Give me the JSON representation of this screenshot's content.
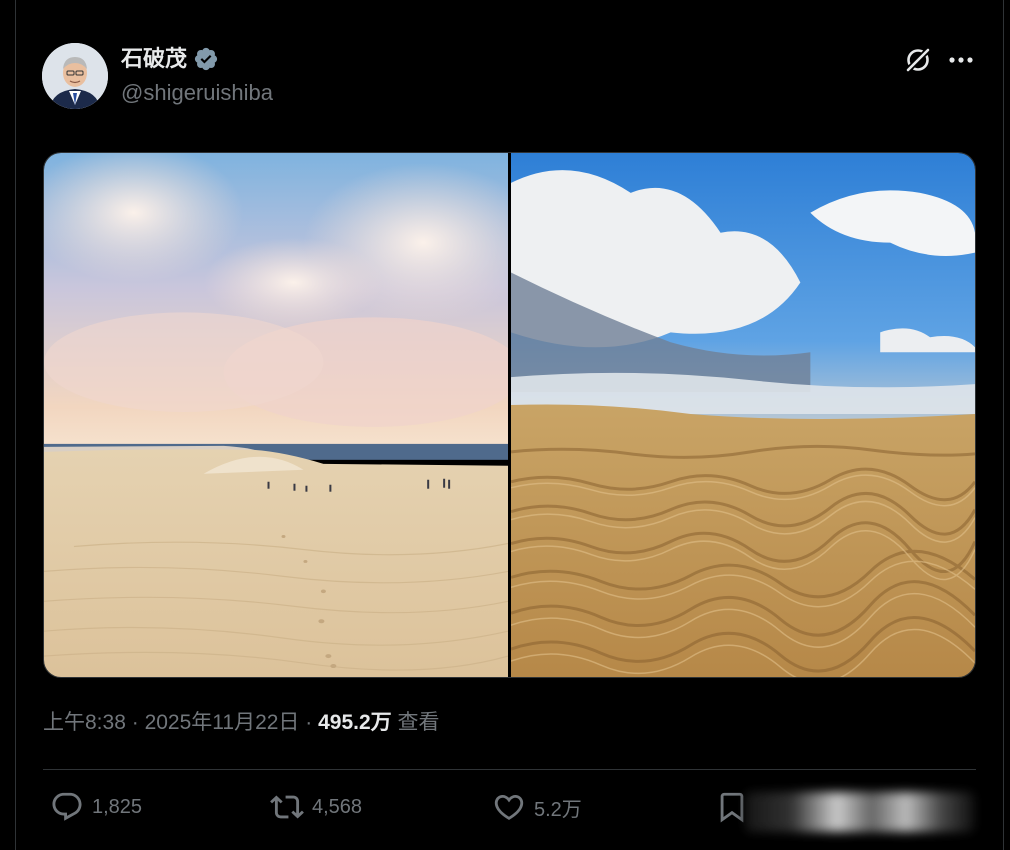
{
  "tweet": {
    "author": {
      "display_name": "石破茂",
      "handle": "@shigeruishiba",
      "verified": true,
      "badge_color": "#829aab"
    },
    "timestamp": {
      "time": "上午8:38",
      "separator": "·",
      "date": "2025年11月22日",
      "views_count": "495.2万",
      "views_label": "查看"
    },
    "media": [
      {
        "icon": "photo-sand-dunes-with-people"
      },
      {
        "icon": "photo-sand-ripples-blue-sky"
      }
    ],
    "actions": {
      "reply_count": "1,825",
      "repost_count": "4,568",
      "like_count": "5.2万"
    }
  },
  "colors": {
    "background": "#000000",
    "text_primary": "#e7e9ea",
    "text_secondary": "#71767b",
    "border": "#2f3336"
  }
}
